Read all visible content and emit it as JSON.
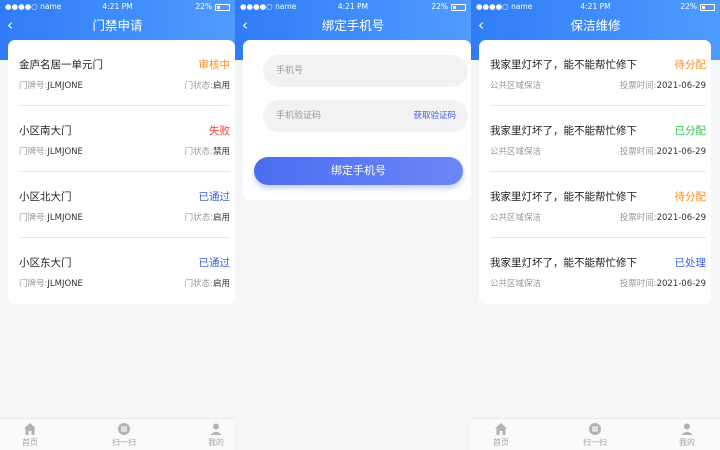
{
  "statusbar": {
    "carrier": "●●●●○ name",
    "time": "4:21 PM",
    "battery": "22%"
  },
  "colors": {
    "blue": "#2f7cf6",
    "orange": "#ff8c1a",
    "red": "#ff3b30",
    "green": "#2ec84d",
    "indigo": "#3e63e0"
  },
  "screen1": {
    "title": "门禁申请",
    "items": [
      {
        "title": "金庐名居一单元门",
        "status": "审核中",
        "status_color": "#ff8c1a",
        "door_label": "门牌号:",
        "door_value": "JLMJONE",
        "state_label": "门状态:",
        "state_value": "启用"
      },
      {
        "title": "小区南大门",
        "status": "失败",
        "status_color": "#ff3b30",
        "door_label": "门牌号:",
        "door_value": "JLMJONE",
        "state_label": "门状态:",
        "state_value": "禁用"
      },
      {
        "title": "小区北大门",
        "status": "已通过",
        "status_color": "#3e63e0",
        "door_label": "门牌号:",
        "door_value": "JLMJONE",
        "state_label": "门状态:",
        "state_value": "启用"
      },
      {
        "title": "小区东大门",
        "status": "已通过",
        "status_color": "#3e63e0",
        "door_label": "门牌号:",
        "door_value": "JLMJONE",
        "state_label": "门状态:",
        "state_value": "启用"
      }
    ]
  },
  "screen2": {
    "title": "绑定手机号",
    "phone_placeholder": "手机号",
    "code_placeholder": "手机验证码",
    "get_code_label": "获取验证码",
    "bind_button_label": "绑定手机号"
  },
  "screen3": {
    "title": "保洁维修",
    "items": [
      {
        "title": "我家里灯坏了，能不能帮忙修下",
        "status": "待分配",
        "status_color": "#ff8c1a",
        "area": "公共区域保洁",
        "time_label": "投票时间:",
        "time_value": "2021-06-29"
      },
      {
        "title": "我家里灯坏了，能不能帮忙修下",
        "status": "已分配",
        "status_color": "#2ec84d",
        "area": "公共区域保洁",
        "time_label": "投票时间:",
        "time_value": "2021-06-29"
      },
      {
        "title": "我家里灯坏了，能不能帮忙修下",
        "status": "待分配",
        "status_color": "#ff8c1a",
        "area": "公共区域保洁",
        "time_label": "投票时间:",
        "time_value": "2021-06-29"
      },
      {
        "title": "我家里灯坏了，能不能帮忙修下",
        "status": "已处理",
        "status_color": "#3e63e0",
        "area": "公共区域保洁",
        "time_label": "投票时间:",
        "time_value": "2021-06-29"
      }
    ]
  },
  "tabbar": {
    "items": [
      {
        "label": "首页",
        "icon": "home-icon"
      },
      {
        "label": "扫一扫",
        "icon": "scan-icon"
      },
      {
        "label": "我的",
        "icon": "user-icon"
      }
    ]
  }
}
